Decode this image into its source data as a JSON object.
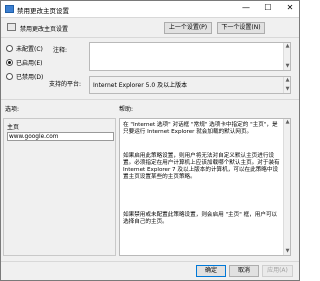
{
  "window": {
    "title": "禁用更改主页设置",
    "minimize_glyph": "—",
    "maximize_glyph": "☐",
    "close_glyph": "✕"
  },
  "header": {
    "policy_name": "禁用更改主页设置",
    "prev_label": "上一个设置(P)",
    "next_label": "下一个设置(N)"
  },
  "state": {
    "options": [
      {
        "label": "未配置(C)",
        "selected": false
      },
      {
        "label": "已启用(E)",
        "selected": true
      },
      {
        "label": "已禁用(D)",
        "selected": false
      }
    ]
  },
  "comment": {
    "label": "注释:"
  },
  "supported": {
    "label": "支持的平台:",
    "value": "Internet Explorer 5.0 及以上版本"
  },
  "options_panel": {
    "label": "选项:",
    "field_label": "主页",
    "field_value": "www.google.com"
  },
  "help_panel": {
    "label": "帮助:",
    "paragraphs": [
      "在 \"Internet 选项\" 对话框 \"常规\" 选项卡中指定的 \"主页\"，是只要运行 Internet Explorer 就会加载的默认网页。",
      "如果启用此策略设置，则用户将无法对自定义默认主页进行设置。必须指定在用户计算机上应该加载哪个默认主页。对于装有 Internet Explorer 7 及以上版本的计算机，可以在此策略中设置主页设置某些的主页策略。",
      "如果禁用或未配置此策略设置，则会启用 \"主页\" 框，用户可以选择自己的主页。"
    ]
  },
  "footer": {
    "ok_label": "确定",
    "cancel_label": "取消",
    "apply_label": "应用(A)"
  },
  "colors": {
    "window_bg": "#f0f0f0",
    "title_icon": "#3c7fd1",
    "ok_border": "#0078d7"
  },
  "icons": [
    "policy-icon",
    "window-icon",
    "scroll-up-icon",
    "scroll-down-icon"
  ]
}
